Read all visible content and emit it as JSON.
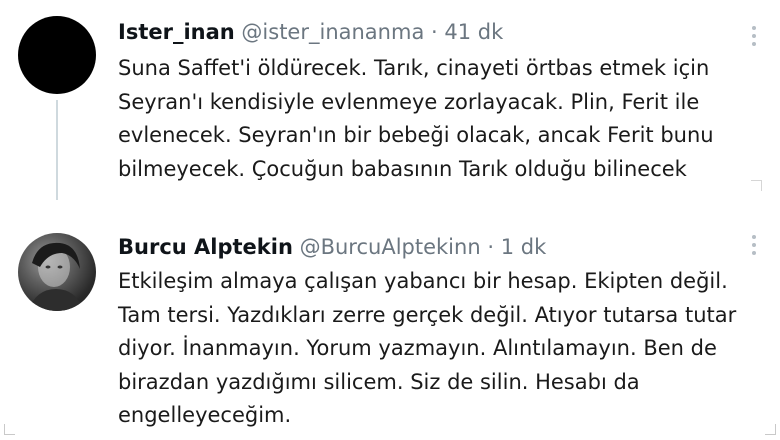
{
  "tweets": [
    {
      "name": "Ister_inan",
      "handle": "@ister_inananma",
      "separator": "·",
      "time": "41 dk",
      "text": "Suna Saffet'i öldürecek. Tarık, cinayeti örtbas etmek için\nSeyran'ı kendisiyle evlenmeye zorlayacak. Plin, Ferit ile\nevlenecek. Seyran'ın bir bebeği olacak, ancak Ferit bunu\nbilmeyecek. Çocuğun babasının Tarık olduğu bilinecek",
      "avatar_color": "#000000"
    },
    {
      "name": "Burcu Alptekin",
      "handle": "@BurcuAlptekinn",
      "separator": "·",
      "time": "1 dk",
      "text": "Etkileşim almaya çalışan yabancı bir hesap. Ekipten değil.\nTam tersi. Yazdıkları zerre gerçek değil. Atıyor tutarsa tutar\ndiyor. İnanmayın. Yorum yazmayın. Alıntılamayın. Ben de\nbirazdan yazdığımı silicem. Siz de silin.  Hesabı da\nengelleyeceğim."
    }
  ],
  "icons": {
    "more": "more-vertical-icon"
  },
  "colors": {
    "name": "#0f1419",
    "secondary_text": "#6b7680",
    "thread_line": "#cfd9de"
  }
}
